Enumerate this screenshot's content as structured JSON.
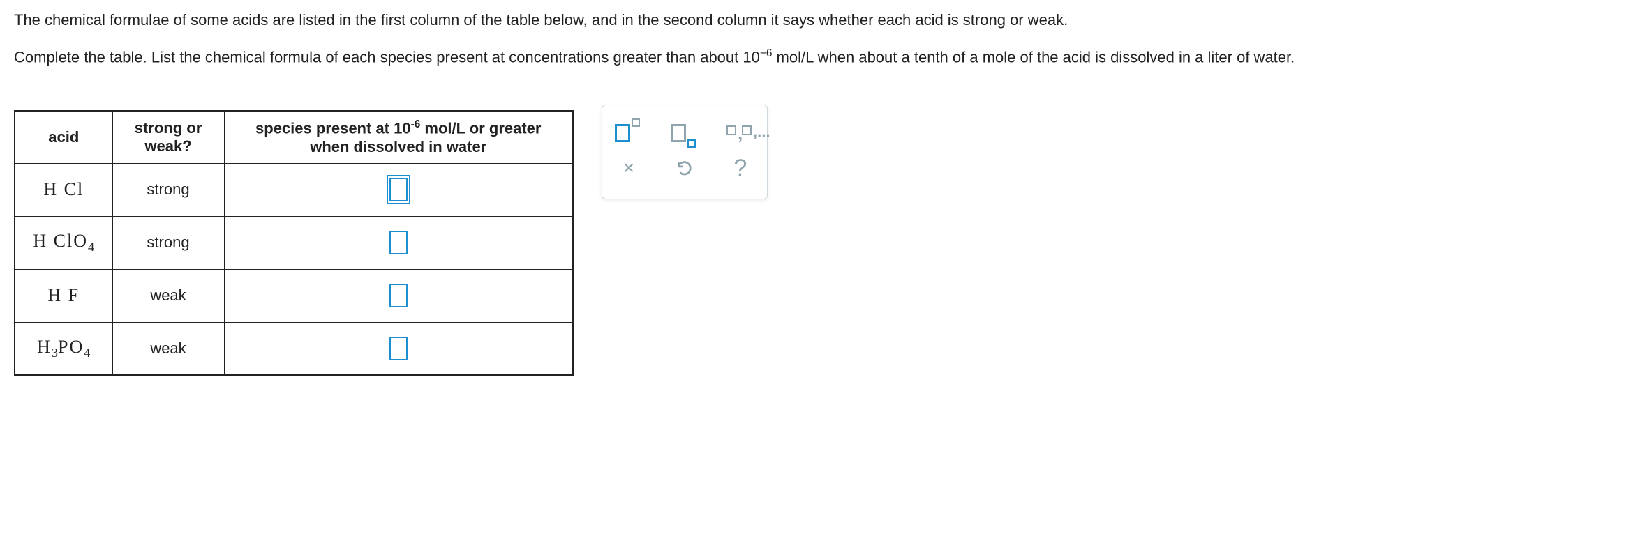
{
  "prompt": {
    "line1": "The chemical formulae of some acids are listed in the first column of the table below, and in the second column it says whether each acid is strong or weak.",
    "line2_pre": "Complete the table. List the chemical formula of each species present at concentrations greater than about 10",
    "line2_exp": "−6",
    "line2_post": " mol/L when about a tenth of a mole of the acid is dissolved in a liter of water."
  },
  "table": {
    "headers": {
      "acid": "acid",
      "strong_weak": "strong or weak?",
      "species_pre": "species present at 10",
      "species_exp": "-6",
      "species_mid": " mol/L or greater",
      "species_sub": "when dissolved in water"
    },
    "rows": [
      {
        "acid_html": "H Cl",
        "strength": "strong",
        "active": true
      },
      {
        "acid_html": "H ClO<sub>4</sub>",
        "strength": "strong",
        "active": false
      },
      {
        "acid_html": "H F",
        "strength": "weak",
        "active": false
      },
      {
        "acid_html": "H<sub>3</sub>PO<sub>4</sub>",
        "strength": "weak",
        "active": false
      }
    ]
  },
  "toolbox": {
    "list_suffix": ",...",
    "clear": "×",
    "help": "?"
  }
}
